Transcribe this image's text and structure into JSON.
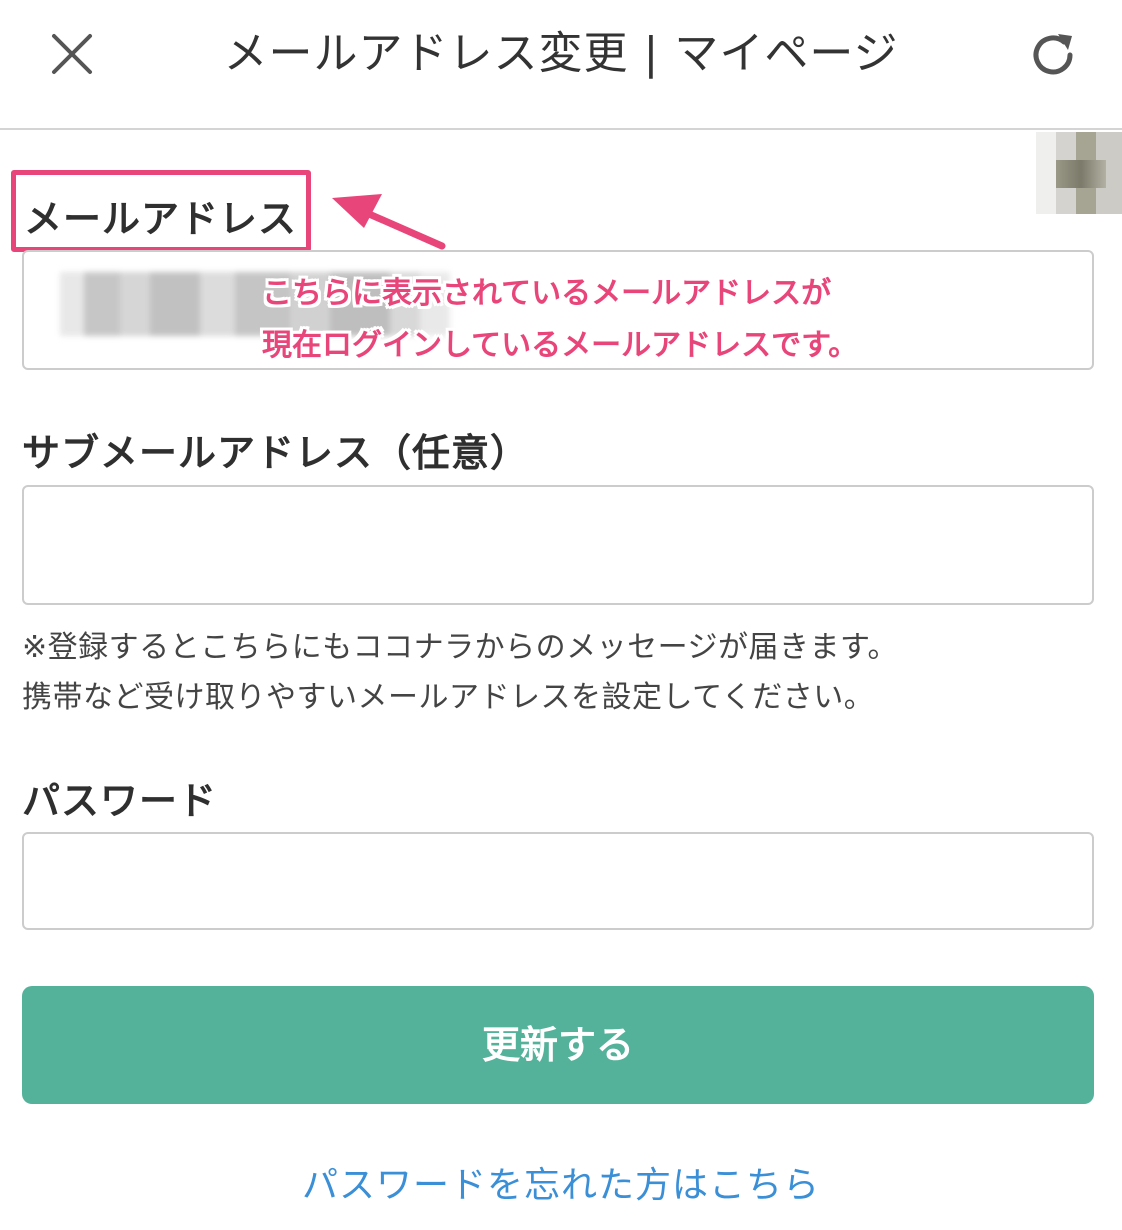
{
  "header": {
    "title": "メールアドレス変更 | マイページ",
    "close_icon": "close-icon",
    "reload_icon": "reload-icon"
  },
  "form": {
    "mail_label": "メールアドレス",
    "mail_value": "",
    "sub_mail_label": "サブメールアドレス（任意）",
    "sub_mail_value": "",
    "note_line1": "※登録するとこちらにもココナラからのメッセージが届きます。",
    "note_line2": "携帯など受け取りやすいメールアドレスを設定してください。",
    "password_label": "パスワード",
    "password_value": "",
    "submit_label": "更新する",
    "forgot_link": "パスワードを忘れた方はこちら"
  },
  "annotation": {
    "line1": "こちらに表示されているメールアドレスが",
    "line2": "現在ログインしているメールアドレスです。",
    "color": "#e8457a"
  },
  "colors": {
    "accent": "#54b19a",
    "link": "#3a8fd6",
    "highlight": "#e8457a"
  }
}
